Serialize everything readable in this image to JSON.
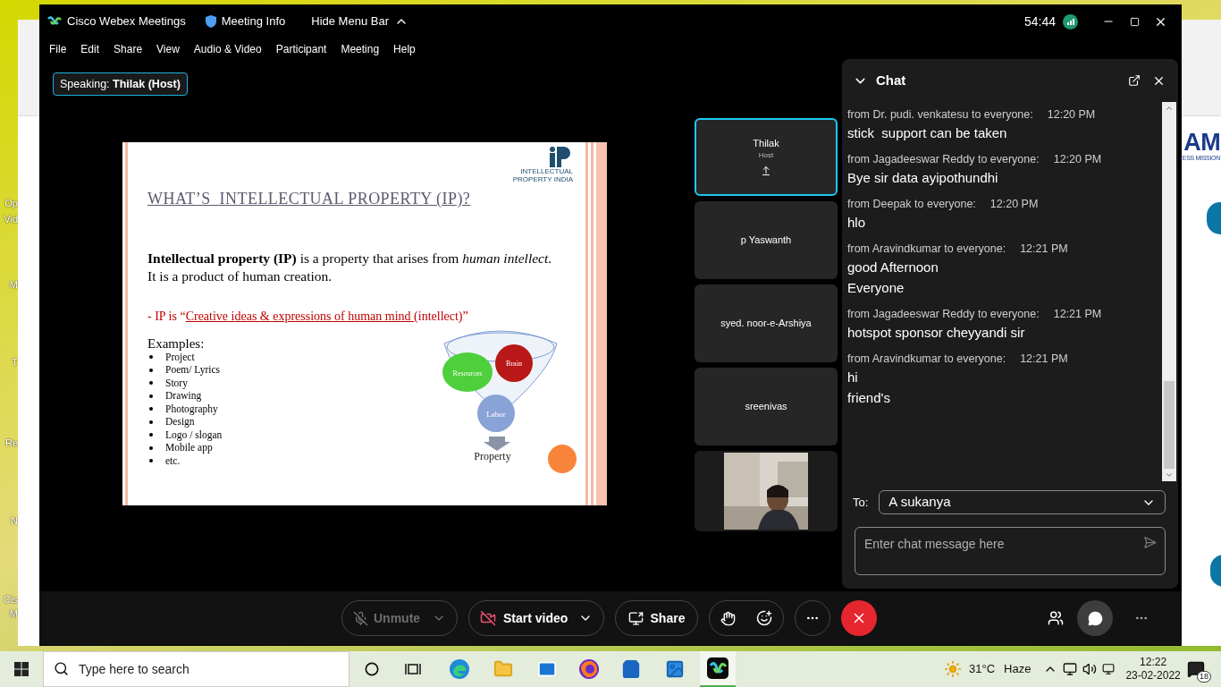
{
  "desktop": {
    "icon_labels": [
      {
        "text": "Op"
      },
      {
        "text": "Vid"
      },
      {
        "text": "M"
      },
      {
        "text": "T"
      },
      {
        "text": "Re"
      },
      {
        "text": "N"
      },
      {
        "text": "Cis"
      },
      {
        "text": "M"
      }
    ]
  },
  "background_page": {
    "logo": "AM",
    "logo_tagline": "ESS MISSION"
  },
  "window": {
    "app_title": "Cisco Webex Meetings",
    "meeting_info": "Meeting Info",
    "hide_menu": "Hide Menu Bar",
    "timer": "54:44"
  },
  "menu": [
    "File",
    "Edit",
    "Share",
    "View",
    "Audio & Video",
    "Participant",
    "Meeting",
    "Help"
  ],
  "speaking": {
    "label": "Speaking:",
    "name": "Thilak (Host)"
  },
  "slide": {
    "logo_lines": [
      "INTELLECTUAL",
      "PROPERTY INDIA"
    ],
    "title": "WHAT’S  INTELLECTUAL PROPERTY (IP)?",
    "paragraph": "**Intellectual property (IP)** is a property that arises from *human intellect*. It is a product of human creation.",
    "quote_prefix": "- IP is “",
    "quote_underlined": "Creative ideas & expressions of human mind ",
    "quote_suffix": "(intellect)”",
    "examples_heading": "Examples:",
    "examples": [
      "Project",
      "Poem/ Lyrics",
      "Story",
      "Drawing",
      "Photography",
      "Design",
      "Logo / slogan",
      "Mobile app",
      "etc."
    ],
    "diagram_labels": {
      "brain": "Brain",
      "resources": "Resources",
      "labor": "Labor",
      "result": "Property"
    }
  },
  "participants": [
    {
      "kind": "tile",
      "name": "Thilak",
      "role": "Host",
      "selected": true,
      "sharing": true
    },
    {
      "kind": "tile",
      "name": "p Yaswanth",
      "selected": false,
      "sharing": false
    },
    {
      "kind": "tile",
      "name": "syed. noor-e-Arshiya",
      "selected": false,
      "sharing": false
    },
    {
      "kind": "tile",
      "name": "sreenivas",
      "selected": false,
      "sharing": false
    },
    {
      "kind": "video",
      "selected": false
    }
  ],
  "chat": {
    "title": "Chat",
    "messages": [
      {
        "sender": "from Dr. pudi. venkatesu to everyone:",
        "time": "12:20 PM",
        "lines": [
          "stick  support can be taken"
        ]
      },
      {
        "sender": "from Jagadeeswar Reddy to everyone:",
        "time": "12:20 PM",
        "lines": [
          "Bye sir data ayipothundhi"
        ]
      },
      {
        "sender": "from Deepak to everyone:",
        "time": "12:20 PM",
        "lines": [
          "hlo"
        ]
      },
      {
        "sender": "from Aravindkumar to everyone:",
        "time": "12:21 PM",
        "lines": [
          "good Afternoon",
          "Everyone"
        ]
      },
      {
        "sender": "from Jagadeeswar Reddy to everyone:",
        "time": "12:21 PM",
        "lines": [
          "hotspot sponsor cheyyandi sir"
        ]
      },
      {
        "sender": "from Aravindkumar to everyone:",
        "time": "12:21 PM",
        "lines": [
          "hi",
          "friend's"
        ]
      }
    ],
    "to_label": "To:",
    "recipient": "A sukanya",
    "placeholder": "Enter chat message here"
  },
  "controls": {
    "unmute": {
      "label": "Unmute",
      "disabled": true
    },
    "start_video": {
      "label": "Start video",
      "disabled": false
    },
    "share": {
      "label": "Share"
    }
  },
  "taskbar": {
    "search_placeholder": "Type here to search",
    "temperature": "31°C",
    "weather": "Haze",
    "time": "12:22",
    "date": "23-02-2022",
    "notifications": "18"
  }
}
